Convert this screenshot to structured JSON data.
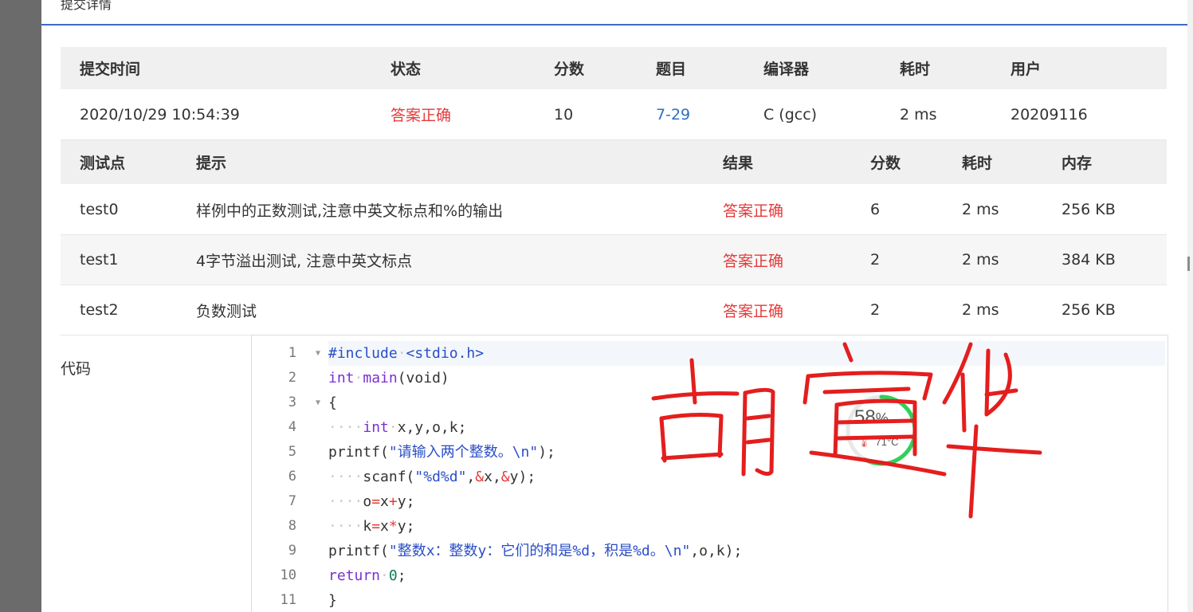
{
  "header": {
    "title_fragment": "提交详情"
  },
  "submission": {
    "columns": [
      "提交时间",
      "状态",
      "分数",
      "题目",
      "编译器",
      "耗时",
      "用户"
    ],
    "row": {
      "time": "2020/10/29 10:54:39",
      "status": "答案正确",
      "score": "10",
      "problem": "7-29",
      "compiler": "C (gcc)",
      "duration": "2 ms",
      "user": "20209116"
    }
  },
  "tests": {
    "columns": [
      "测试点",
      "提示",
      "结果",
      "分数",
      "耗时",
      "内存"
    ],
    "rows": [
      {
        "name": "test0",
        "hint": "样例中的正数测试,注意中英文标点和%的输出",
        "result": "答案正确",
        "score": "6",
        "time": "2 ms",
        "memory": "256 KB"
      },
      {
        "name": "test1",
        "hint": "4字节溢出测试, 注意中英文标点",
        "result": "答案正确",
        "score": "2",
        "time": "2 ms",
        "memory": "384 KB"
      },
      {
        "name": "test2",
        "hint": "负数测试",
        "result": "答案正确",
        "score": "2",
        "time": "2 ms",
        "memory": "256 KB"
      }
    ]
  },
  "code": {
    "label": "代码",
    "line_numbers": [
      "1",
      "2",
      "3",
      "4",
      "5",
      "6",
      "7",
      "8",
      "9",
      "10",
      "11"
    ],
    "lines": [
      "#include <stdio.h>",
      "int main(void)",
      "{",
      "    int x,y,o,k;",
      "printf(\"请输入两个整数。\\n\");",
      "    scanf(\"%d%d\",&x,&y);",
      "    o=x+y;",
      "    k=x*y;",
      "printf(\"整数x：整数y：它们的和是%d，积是%d。\\n\",o,k);",
      "return 0;",
      "}"
    ]
  },
  "monitor_widget": {
    "percent": "58",
    "percent_symbol": "%",
    "temperature": "71°C",
    "level": 0.58,
    "ring_color": "#2fd15a"
  },
  "annotation": {
    "handwriting": "胡宣华",
    "ink_color": "#e41e1e"
  },
  "colors": {
    "accent": "#3b6cc2",
    "status_ok": "#e53a3a",
    "link": "#2f6fc2"
  }
}
